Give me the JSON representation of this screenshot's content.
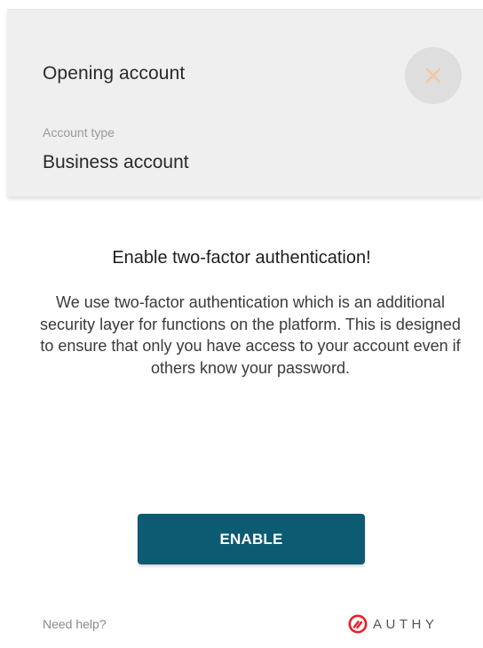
{
  "dialog": {
    "title": "Opening account",
    "close_icon": "close-icon",
    "field_label": "Account type",
    "field_value": "Business account"
  },
  "content": {
    "heading": "Enable two-factor authentication!",
    "description": "We use two-factor authentication which is an additional security layer for functions on the platform. This is designed to ensure that only you have access to your account even if others know your password."
  },
  "actions": {
    "enable_label": "ENABLE"
  },
  "footer": {
    "help_label": "Need help?",
    "brand_name": "AUTHY",
    "brand_icon": "authy-logo-icon"
  },
  "colors": {
    "primary_button": "#0d5a73",
    "close_accent": "#f3c9a0",
    "brand_red": "#ec1c24",
    "header_bg": "#efefef"
  }
}
